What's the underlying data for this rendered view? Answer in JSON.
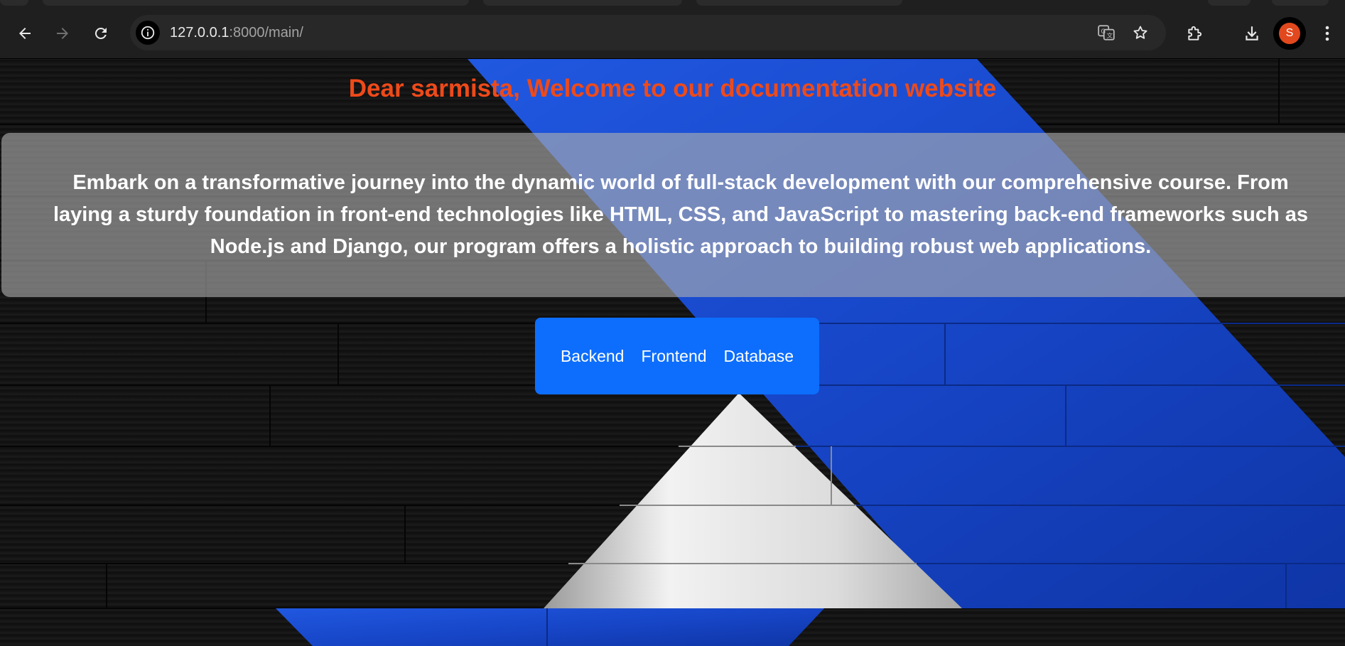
{
  "browser": {
    "url_host": "127.0.0.1",
    "url_path": ":8000/main/",
    "profile_initial": "S",
    "icons": {
      "back": "back-arrow-icon",
      "forward": "forward-arrow-icon",
      "reload": "reload-icon",
      "site_info": "info-icon",
      "translate": "translate-icon",
      "bookmark": "star-icon",
      "extensions": "puzzle-icon",
      "downloads": "download-icon",
      "menu": "kebab-menu-icon"
    }
  },
  "page": {
    "welcome": "Dear sarmista, Welcome to our documentation website",
    "intro": "Embark on a transformative journey into the dynamic world of full-stack development with our comprehensive course. From laying a sturdy foundation in front-end technologies like HTML, CSS, and JavaScript to mastering back-end frameworks such as Node.js and Django, our program offers a holistic approach to building robust web applications.",
    "nav": {
      "backend": "Backend",
      "frontend": "Frontend",
      "database": "Database"
    }
  },
  "colors": {
    "welcome_text": "#ee4a1a",
    "nav_bg": "#0d6efd",
    "accent_blue": "#1746c8",
    "avatar_bg": "#e2481e"
  }
}
